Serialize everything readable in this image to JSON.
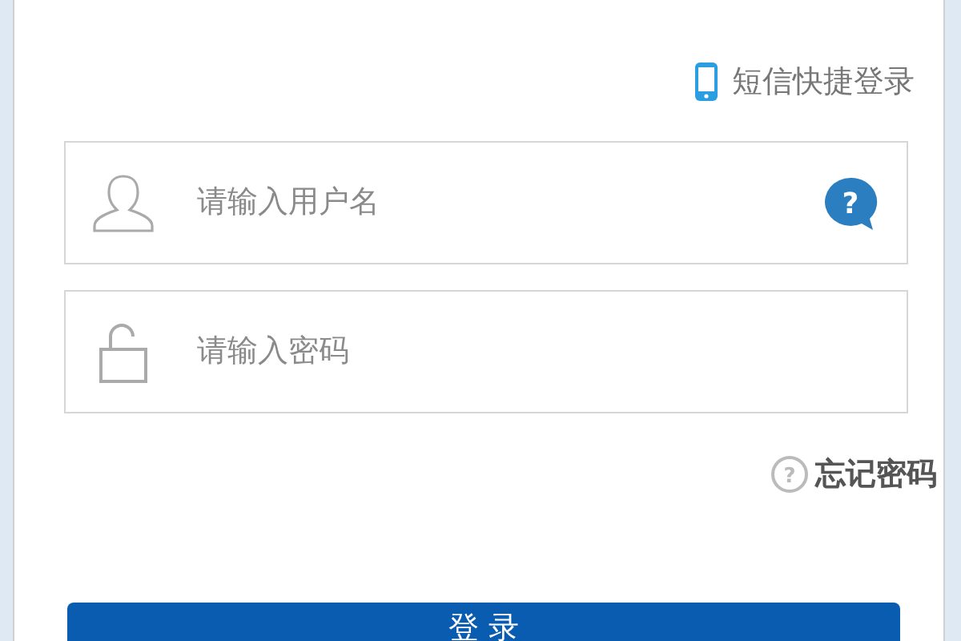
{
  "sms_login_link": "短信快捷登录",
  "fields": [
    {
      "kind": "username",
      "placeholder": "请输入用户名",
      "help_glyph": "?"
    },
    {
      "kind": "password",
      "placeholder": "请输入密码"
    }
  ],
  "forgot_password_link": "忘记密码",
  "forgot_glyph": "?",
  "login_button": "登 录"
}
